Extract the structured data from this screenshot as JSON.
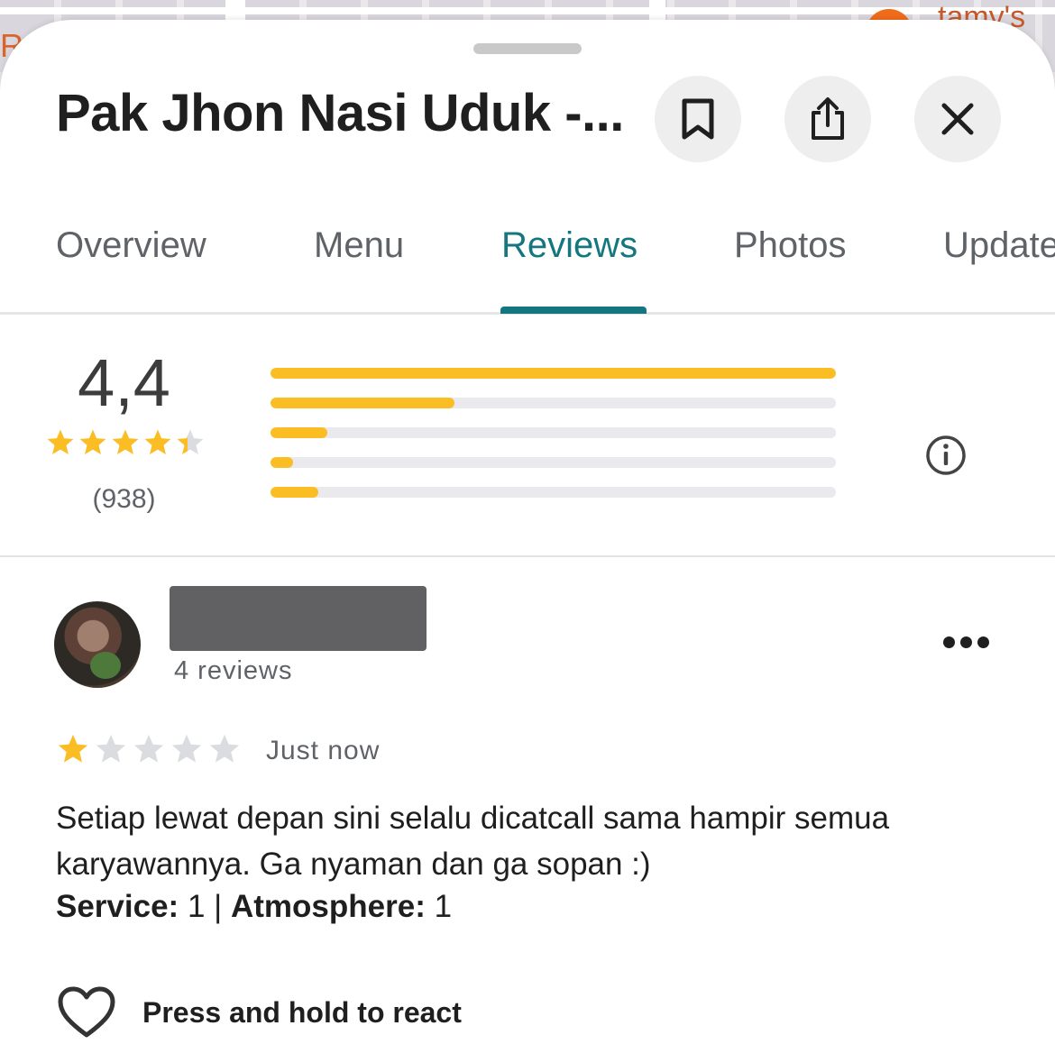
{
  "map": {
    "left_label": "R",
    "right_label": "tamy's"
  },
  "place": {
    "title": "Pak Jhon Nasi Uduk -..."
  },
  "actions": {
    "save_icon": "bookmark-icon",
    "share_icon": "share-icon",
    "close_icon": "close-icon"
  },
  "tabs": [
    {
      "label": "Overview"
    },
    {
      "label": "Menu"
    },
    {
      "label": "Reviews",
      "active": true
    },
    {
      "label": "Photos"
    },
    {
      "label": "Updates"
    }
  ],
  "rating_summary": {
    "average": "4,4",
    "stars": 4.4,
    "count": "(938)",
    "distribution": [
      {
        "stars": 5,
        "fraction": 1.0
      },
      {
        "stars": 4,
        "fraction": 0.325
      },
      {
        "stars": 3,
        "fraction": 0.1
      },
      {
        "stars": 2,
        "fraction": 0.04
      },
      {
        "stars": 1,
        "fraction": 0.085
      }
    ]
  },
  "review": {
    "reviewer_reviews": "4 reviews",
    "stars": 1,
    "time": "Just now",
    "text": "Setiap lewat depan sini selalu dicatcall sama hampir semua karyawannya. Ga nyaman dan ga sopan :)",
    "service_label": "Service:",
    "service_value": "1",
    "separator": "|",
    "atmosphere_label": "Atmosphere:",
    "atmosphere_value": "1",
    "react_label": "Press and hold to react"
  },
  "colors": {
    "accent": "#14777f",
    "star": "#fbbd24",
    "star_empty": "#dadce0"
  }
}
